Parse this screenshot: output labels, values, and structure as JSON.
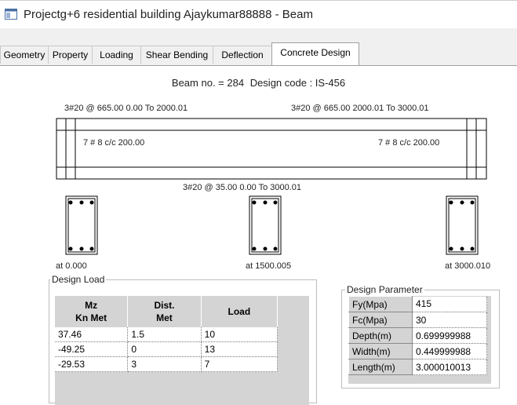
{
  "window": {
    "title": "Projectg+6 residential building Ajaykumar88888 - Beam"
  },
  "tabs": [
    "Geometry",
    "Property",
    "Loading",
    "Shear Bending",
    "Deflection",
    "Concrete Design"
  ],
  "active_tab": "Concrete Design",
  "header": {
    "beam_no": "Beam no. = 284",
    "design_code": "Design code :  IS-456"
  },
  "beam": {
    "top_left_rebar": "3#20 @ 665.00 0.00 To 2000.01",
    "top_right_rebar": "3#20 @ 665.00 2000.01 To 3000.01",
    "left_stirrup": "7 # 8 c/c 200.00",
    "right_stirrup": "7 # 8 c/c 200.00",
    "bottom_rebar": "3#20 @ 35.00 0.00 To 3000.01"
  },
  "sections": [
    {
      "label": "at 0.000"
    },
    {
      "label": "at 1500.005"
    },
    {
      "label": "at 3000.010"
    }
  ],
  "design_load": {
    "title": "Design Load",
    "headers": [
      [
        "Mz",
        "Kn Met"
      ],
      [
        "Dist.",
        "Met"
      ],
      [
        "Load"
      ]
    ],
    "rows": [
      [
        "37.46",
        "1.5",
        "10"
      ],
      [
        "-49.25",
        "0",
        "13"
      ],
      [
        "-29.53",
        "3",
        "7"
      ]
    ]
  },
  "design_parameter": {
    "title": "Design Parameter",
    "rows": [
      [
        "Fy(Mpa)",
        "415"
      ],
      [
        "Fc(Mpa)",
        "30"
      ],
      [
        "Depth(m)",
        "0.699999988"
      ],
      [
        "Width(m)",
        "0.449999988"
      ],
      [
        "Length(m)",
        "3.000010013"
      ]
    ]
  },
  "colors": {
    "accent_stub": "#1e5fb3",
    "grid_header": "#d4d4d4",
    "window_bg": "#f0f0f0"
  }
}
